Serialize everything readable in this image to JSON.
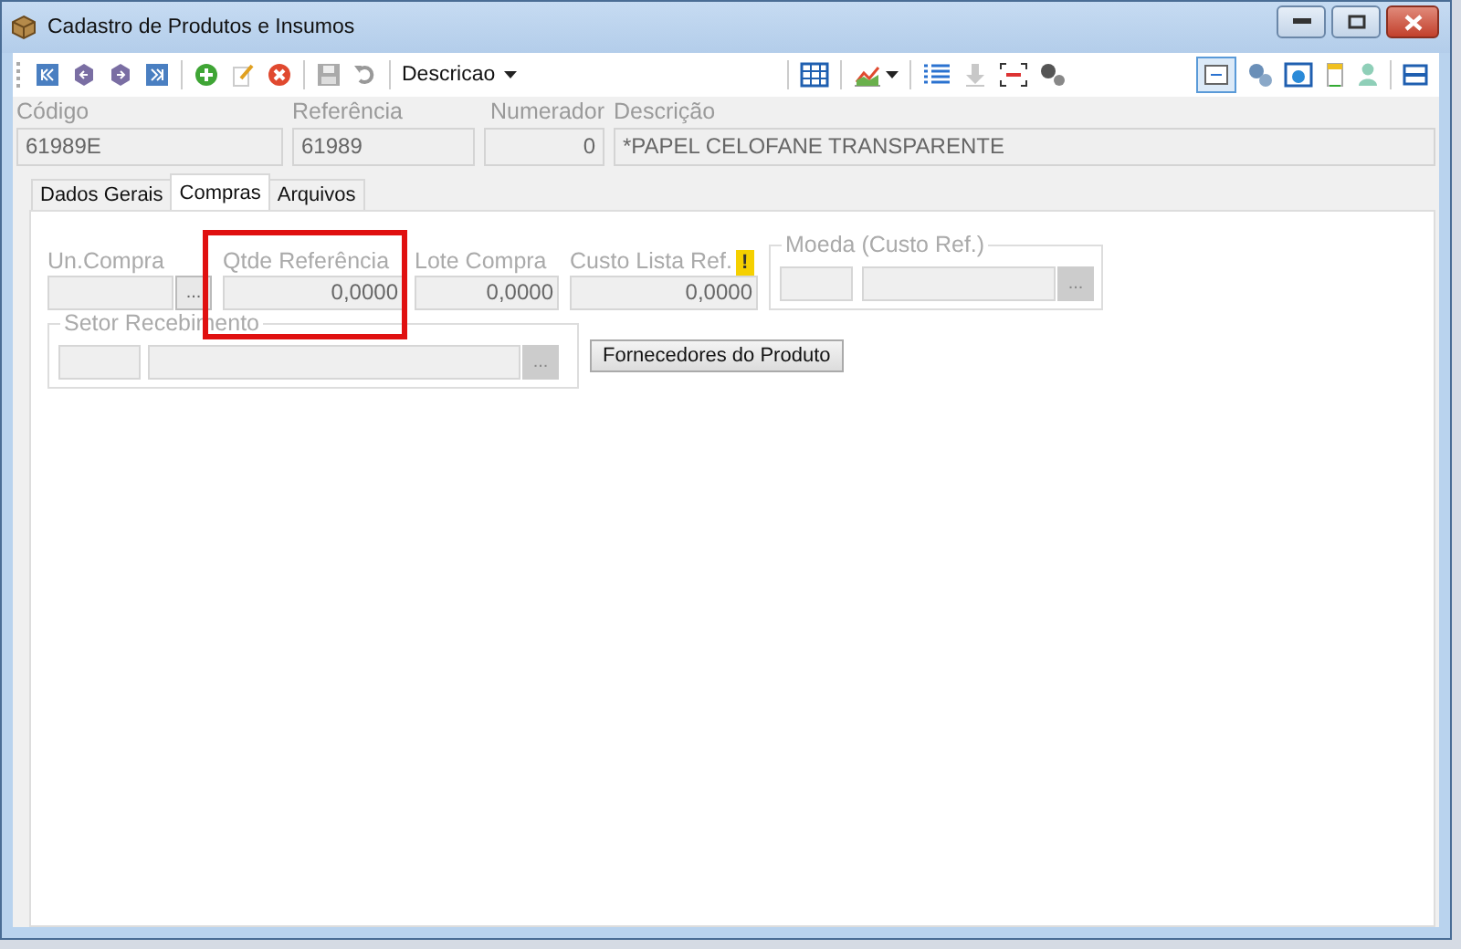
{
  "window": {
    "title": "Cadastro de Produtos e Insumos"
  },
  "toolbar": {
    "search_mode": "Descricao"
  },
  "header_fields": [
    {
      "label": "Código",
      "value": "61989E"
    },
    {
      "label": "Referência",
      "value": "61989"
    },
    {
      "label": "Numerador",
      "value": "0"
    },
    {
      "label": "Descrição",
      "value": "*PAPEL CELOFANE TRANSPARENTE"
    }
  ],
  "tabs": [
    {
      "label": "Dados Gerais",
      "selected": false
    },
    {
      "label": "Compras",
      "selected": true
    },
    {
      "label": "Arquivos",
      "selected": false
    }
  ],
  "compras": {
    "un_compra": {
      "label": "Un.Compra",
      "browse": "..."
    },
    "qtde_referencia": {
      "label": "Qtde Referência",
      "value": "0,0000"
    },
    "lote_compra": {
      "label": "Lote Compra",
      "value": "0,0000"
    },
    "custo_lista_ref": {
      "label": "Custo Lista Ref.",
      "value": "0,0000",
      "warning": "!"
    },
    "moeda": {
      "label": "Moeda (Custo Ref.)",
      "browse": "..."
    },
    "setor_recebimento": {
      "label": "Setor Recebimento",
      "browse": "..."
    },
    "fornecedores_button": "Fornecedores do Produto"
  }
}
